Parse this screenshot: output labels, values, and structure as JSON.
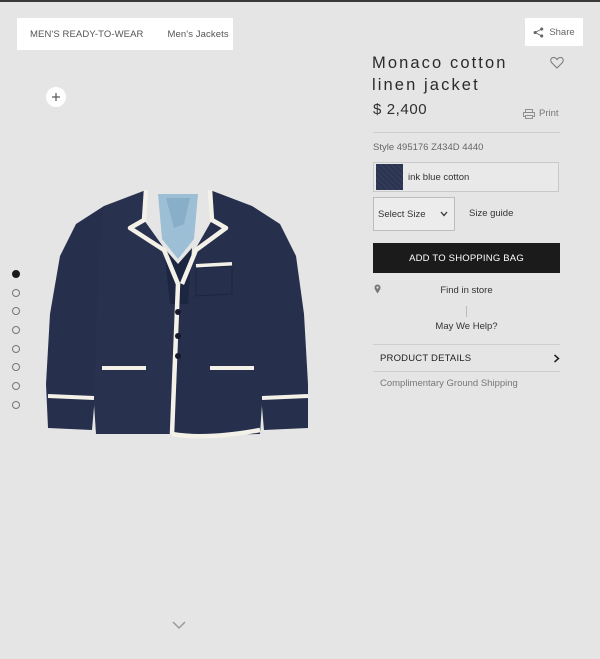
{
  "breadcrumb": {
    "items": [
      {
        "label": "MEN'S READY-TO-WEAR"
      },
      {
        "label": "Men's Jackets"
      }
    ]
  },
  "share": {
    "label": "Share",
    "icon": "share-icon"
  },
  "gallery": {
    "zoom_icon": "plus-icon",
    "image_alt": "navy cotton linen blazer with white piping",
    "dot_count": 8,
    "active_dot": 1,
    "scroll_icon": "chevron-down-icon"
  },
  "product": {
    "title_line1": "Monaco cotton",
    "title_line2": "linen jacket",
    "price": "$ 2,400",
    "print_label": "Print",
    "style_code": "Style 495176 Z434D 4440",
    "color_label": "ink blue cotton",
    "size_select": {
      "selected": "Select Size"
    },
    "size_guide": "Size guide",
    "add_to_bag": "ADD TO SHOPPING BAG",
    "find_in_store": "Find in store",
    "help": "May We Help?",
    "details": "PRODUCT DETAILS",
    "shipping": "Complimentary Ground Shipping"
  },
  "colors": {
    "background": "#e5e5e5",
    "button": "#1b1b1b",
    "jacket": "#25304d",
    "piping": "#f4f1e8",
    "lining": "#9dbfd6"
  }
}
